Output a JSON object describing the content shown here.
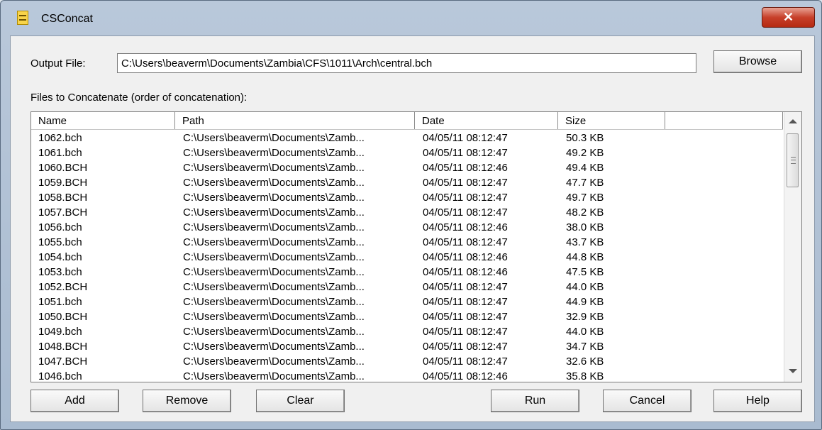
{
  "window": {
    "title": "CSConcat",
    "close_glyph": "✕"
  },
  "output": {
    "label": "Output File:",
    "value": "C:\\Users\\beaverm\\Documents\\Zambia\\CFS\\1011\\Arch\\central.bch",
    "browse_label": "Browse"
  },
  "files": {
    "label": "Files to Concatenate (order of concatenation):",
    "columns": [
      "Name",
      "Path",
      "Date",
      "Size"
    ],
    "rows": [
      {
        "name": "1062.bch",
        "path": "C:\\Users\\beaverm\\Documents\\Zamb...",
        "date": "04/05/11 08:12:47",
        "size": "50.3 KB"
      },
      {
        "name": "1061.bch",
        "path": "C:\\Users\\beaverm\\Documents\\Zamb...",
        "date": "04/05/11 08:12:47",
        "size": "49.2 KB"
      },
      {
        "name": "1060.BCH",
        "path": "C:\\Users\\beaverm\\Documents\\Zamb...",
        "date": "04/05/11 08:12:46",
        "size": "49.4 KB"
      },
      {
        "name": "1059.BCH",
        "path": "C:\\Users\\beaverm\\Documents\\Zamb...",
        "date": "04/05/11 08:12:47",
        "size": "47.7 KB"
      },
      {
        "name": "1058.BCH",
        "path": "C:\\Users\\beaverm\\Documents\\Zamb...",
        "date": "04/05/11 08:12:47",
        "size": "49.7 KB"
      },
      {
        "name": "1057.BCH",
        "path": "C:\\Users\\beaverm\\Documents\\Zamb...",
        "date": "04/05/11 08:12:47",
        "size": "48.2 KB"
      },
      {
        "name": "1056.bch",
        "path": "C:\\Users\\beaverm\\Documents\\Zamb...",
        "date": "04/05/11 08:12:46",
        "size": "38.0 KB"
      },
      {
        "name": "1055.bch",
        "path": "C:\\Users\\beaverm\\Documents\\Zamb...",
        "date": "04/05/11 08:12:47",
        "size": "43.7 KB"
      },
      {
        "name": "1054.bch",
        "path": "C:\\Users\\beaverm\\Documents\\Zamb...",
        "date": "04/05/11 08:12:46",
        "size": "44.8 KB"
      },
      {
        "name": "1053.bch",
        "path": "C:\\Users\\beaverm\\Documents\\Zamb...",
        "date": "04/05/11 08:12:46",
        "size": "47.5 KB"
      },
      {
        "name": "1052.BCH",
        "path": "C:\\Users\\beaverm\\Documents\\Zamb...",
        "date": "04/05/11 08:12:47",
        "size": "44.0 KB"
      },
      {
        "name": "1051.bch",
        "path": "C:\\Users\\beaverm\\Documents\\Zamb...",
        "date": "04/05/11 08:12:47",
        "size": "44.9 KB"
      },
      {
        "name": "1050.BCH",
        "path": "C:\\Users\\beaverm\\Documents\\Zamb...",
        "date": "04/05/11 08:12:47",
        "size": "32.9 KB"
      },
      {
        "name": "1049.bch",
        "path": "C:\\Users\\beaverm\\Documents\\Zamb...",
        "date": "04/05/11 08:12:47",
        "size": "44.0 KB"
      },
      {
        "name": "1048.BCH",
        "path": "C:\\Users\\beaverm\\Documents\\Zamb...",
        "date": "04/05/11 08:12:47",
        "size": "34.7 KB"
      },
      {
        "name": "1047.BCH",
        "path": "C:\\Users\\beaverm\\Documents\\Zamb...",
        "date": "04/05/11 08:12:47",
        "size": "32.6 KB"
      },
      {
        "name": "1046.bch",
        "path": "C:\\Users\\beaverm\\Documents\\Zamb...",
        "date": "04/05/11 08:12:46",
        "size": "35.8 KB"
      }
    ]
  },
  "buttons": {
    "add": "Add",
    "remove": "Remove",
    "clear": "Clear",
    "run": "Run",
    "cancel": "Cancel",
    "help": "Help"
  }
}
